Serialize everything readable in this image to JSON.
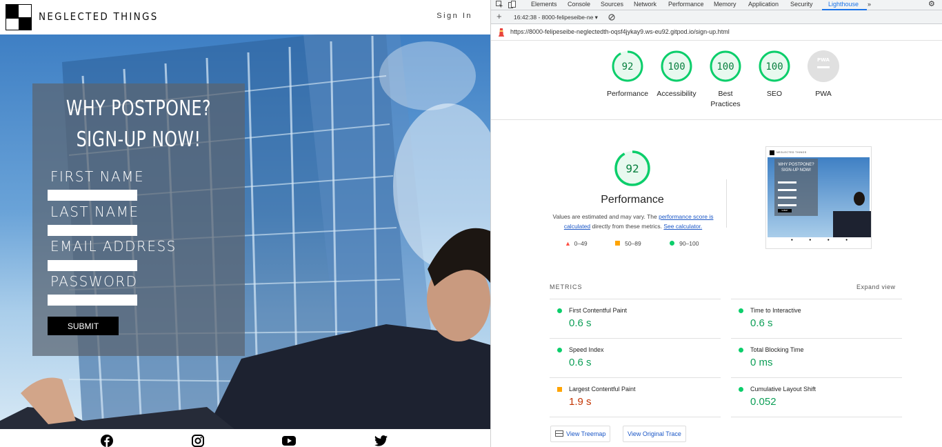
{
  "site": {
    "brand": "NEGLECTED THINGS",
    "signin": "Sign In",
    "form": {
      "title_line1": "WHY POSTPONE?",
      "title_line2": "SIGN-UP NOW!",
      "labels": [
        "FIRST NAME",
        "LAST NAME",
        "EMAIL ADDRESS",
        "PASSWORD"
      ],
      "submit": "SUBMIT"
    },
    "social_icons": [
      "facebook-icon",
      "instagram-icon",
      "youtube-icon",
      "twitter-icon"
    ]
  },
  "devtools": {
    "tabs": [
      "Elements",
      "Console",
      "Sources",
      "Network",
      "Performance",
      "Memory",
      "Application",
      "Security",
      "Lighthouse"
    ],
    "active_tab": "Lighthouse",
    "more": "»",
    "report_selector": "16:42:38 - 8000-felipeseibe-ne",
    "url": "https://8000-felipeseibe-neglectedth-oqsf4jykay9.ws-eu92.gitpod.io/sign-up.html",
    "scores": [
      {
        "label": "Performance",
        "value": "92",
        "pct": 0.92
      },
      {
        "label": "Accessibility",
        "value": "100",
        "pct": 1.0
      },
      {
        "label": "Best Practices",
        "value": "100",
        "pct": 1.0
      },
      {
        "label": "SEO",
        "value": "100",
        "pct": 1.0
      },
      {
        "label": "PWA",
        "value": "PWA",
        "pct": 0
      }
    ],
    "performance": {
      "score": "92",
      "score_pct": 0.92,
      "title": "Performance",
      "desc_1": "Values are estimated and may vary. The ",
      "desc_link1": "performance score is calculated",
      "desc_2": " directly from these metrics. ",
      "desc_link2": "See calculator.",
      "legend": [
        "0–49",
        "50–89",
        "90–100"
      ]
    },
    "metrics_label": "METRICS",
    "expand_view": "Expand view",
    "metrics": [
      {
        "name": "First Contentful Paint",
        "value": "0.6 s",
        "status": "pass"
      },
      {
        "name": "Time to Interactive",
        "value": "0.6 s",
        "status": "pass"
      },
      {
        "name": "Speed Index",
        "value": "0.6 s",
        "status": "pass"
      },
      {
        "name": "Total Blocking Time",
        "value": "0 ms",
        "status": "pass"
      },
      {
        "name": "Largest Contentful Paint",
        "value": "1.9 s",
        "status": "average"
      },
      {
        "name": "Cumulative Layout Shift",
        "value": "0.052",
        "status": "pass"
      }
    ],
    "buttons": {
      "treemap": "View Treemap",
      "trace": "View Original Trace"
    },
    "thumbnail": {
      "brand": "NEGLECTED THINGS",
      "title_line1": "WHY POSTPONE?",
      "title_line2": "SIGN-UP NOW!",
      "submit": "SUBMIT"
    },
    "colors": {
      "pass": "#0cce6b",
      "average": "#ffa400",
      "fail": "#ff4e42",
      "accent": "#1a73e8"
    }
  }
}
